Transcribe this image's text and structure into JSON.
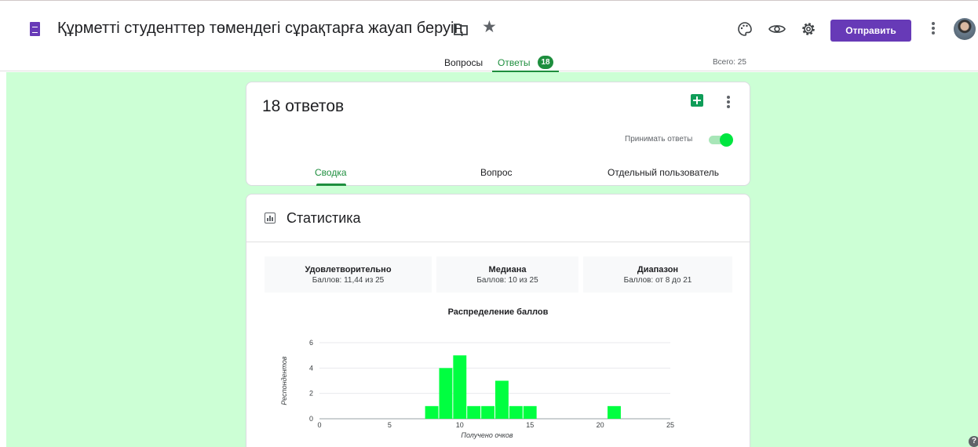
{
  "header": {
    "doc_icon": "forms-doc-icon",
    "title": "Құрметті студенттер төмендегі сұрақтарға жауап беруің",
    "send_label": "Отправить",
    "icons": [
      "folder-icon",
      "star-icon",
      "palette-icon",
      "eye-icon",
      "gear-icon",
      "more-vert-icon",
      "avatar"
    ]
  },
  "tabs": {
    "questions": "Вопросы",
    "answers": "Ответы",
    "answers_badge": "18",
    "total": "Всего: 25"
  },
  "summary": {
    "count_title": "18 ответов",
    "accept_label": "Принимать ответы",
    "accepting": true,
    "sub_tabs": [
      "Сводка",
      "Вопрос",
      "Отдельный пользователь"
    ]
  },
  "stats": {
    "title": "Статистика",
    "boxes": [
      {
        "title": "Удовлетворительно",
        "value": "Баллов: 11,44 из 25"
      },
      {
        "title": "Медиана",
        "value": "Баллов: 10 из 25"
      },
      {
        "title": "Диапазон",
        "value": "Баллов: от 8 до 21"
      }
    ]
  },
  "colors": {
    "accent": "#673ab7",
    "tab_green": "#1e8e3e",
    "canvas": "#ccffd5",
    "bar": "#00ff40"
  },
  "chart_data": {
    "type": "bar",
    "title": "Распределение баллов",
    "xlabel": "Получено очков",
    "ylabel": "Респондентов",
    "x": [
      8,
      9,
      10,
      11,
      12,
      13,
      14,
      15,
      21
    ],
    "values": [
      1,
      4,
      5,
      1,
      1,
      3,
      1,
      1,
      1
    ],
    "xlim": [
      0,
      25
    ],
    "ylim": [
      0,
      6
    ],
    "x_ticks": [
      "0",
      "5",
      "10",
      "15",
      "20",
      "25"
    ],
    "y_ticks": [
      "0",
      "2",
      "4",
      "6"
    ],
    "grid": true
  },
  "help_label": "?"
}
